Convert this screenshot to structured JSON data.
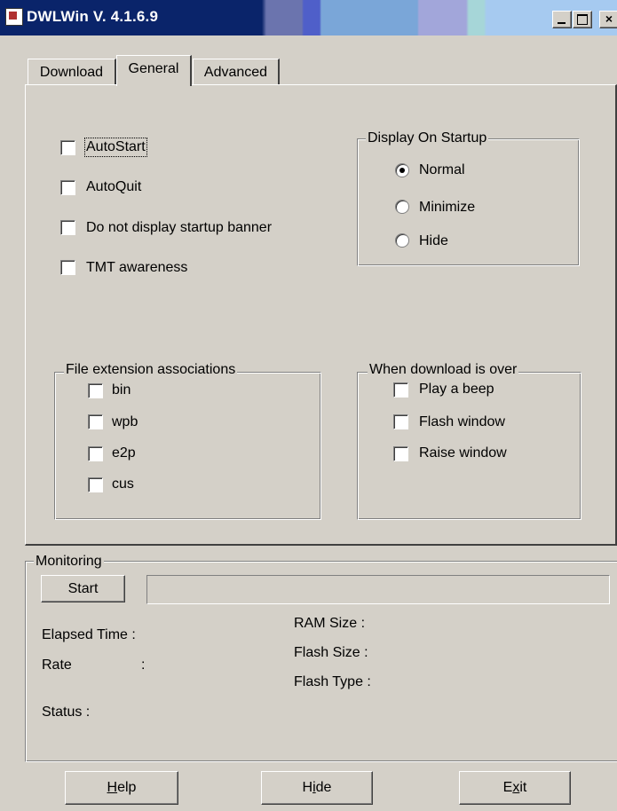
{
  "window": {
    "title": "DWLWin V. 4.1.6.9",
    "caption_min": "_",
    "caption_max": "",
    "caption_close": "×"
  },
  "tabs": [
    {
      "label": "Download",
      "selected": false
    },
    {
      "label": "General",
      "selected": true
    },
    {
      "label": "Advanced",
      "selected": false
    }
  ],
  "general": {
    "options": [
      {
        "label": "AutoStart",
        "checked": false
      },
      {
        "label": "AutoQuit",
        "checked": false
      },
      {
        "label": "Do not display startup banner",
        "checked": false
      },
      {
        "label": "TMT awareness",
        "checked": false
      }
    ],
    "display_on_startup": {
      "title": "Display On Startup",
      "options": [
        {
          "label": "Normal",
          "selected": true
        },
        {
          "label": "Minimize",
          "selected": false
        },
        {
          "label": "Hide",
          "selected": false
        }
      ]
    },
    "file_ext": {
      "title": "File extension associations",
      "items": [
        {
          "label": "bin",
          "checked": false
        },
        {
          "label": "wpb",
          "checked": false
        },
        {
          "label": "e2p",
          "checked": false
        },
        {
          "label": "cus",
          "checked": false
        }
      ]
    },
    "download_over": {
      "title": "When download is over",
      "items": [
        {
          "label": "Play a beep",
          "checked": false
        },
        {
          "label": "Flash window",
          "checked": false
        },
        {
          "label": "Raise window",
          "checked": false
        }
      ]
    }
  },
  "monitoring": {
    "title": "Monitoring",
    "start_label": "Start",
    "elapsed_label": "Elapsed Time :",
    "rate_label": "Rate",
    "rate_colon": ":",
    "status_label": "Status :",
    "ram_label": "RAM Size  :",
    "flash_size_label": "Flash Size  :",
    "flash_type_label": "Flash Type :"
  },
  "buttons": {
    "help": {
      "pre": "",
      "key": "H",
      "post": "elp"
    },
    "hide": {
      "pre": "H",
      "key": "i",
      "post": "de"
    },
    "exit": {
      "pre": "E",
      "key": "x",
      "post": "it"
    }
  }
}
